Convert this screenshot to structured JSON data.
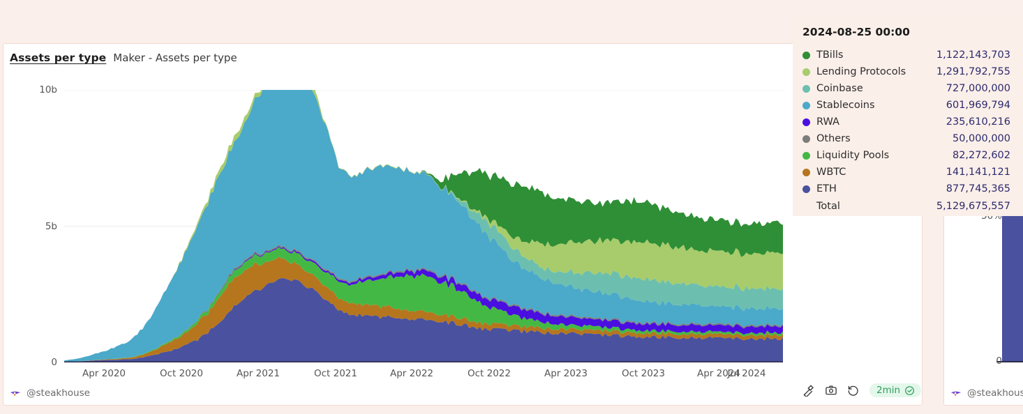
{
  "theme": {
    "page_bg": "#fbefeb",
    "panel_bg": "#ffffff",
    "panel_border": "#f0d9d1",
    "tooltip_bg": "#fbefe9",
    "value_text": "#2b2a6e",
    "badge_green": "#2f9e5c"
  },
  "main_panel": {
    "title": "Assets per type",
    "subtitle": "Maker - Assets per type",
    "watermark": "@steakhouse",
    "footer": {
      "plug_icon": "plug-icon",
      "camera_icon": "camera-icon",
      "undo_icon": "undo-icon",
      "refresh_label": "2min",
      "check_icon": "check-badge-icon"
    }
  },
  "right_panel": {
    "watermark": "@steakhouse",
    "y_ticks": [
      "50%",
      "0"
    ]
  },
  "legend": {
    "items": [
      {
        "label": "RWA",
        "color": "#4a0ee0"
      },
      {
        "label": "Others",
        "color": "#7c7c7c"
      },
      {
        "label": "Liquidity Pools",
        "color": "#44b844"
      },
      {
        "label": "WBTC",
        "color": "#b5761e"
      },
      {
        "label": "ETH",
        "color": "#4a519e"
      }
    ]
  },
  "tooltip": {
    "date": "2024-08-25 00:00",
    "rows": [
      {
        "label": "TBills",
        "value": "1,122,143,703",
        "color": "#2f8f36"
      },
      {
        "label": "Lending Protocols",
        "value": "1,291,792,755",
        "color": "#a8cc6b"
      },
      {
        "label": "Coinbase",
        "value": "727,000,000",
        "color": "#6cbfae"
      },
      {
        "label": "Stablecoins",
        "value": "601,969,794",
        "color": "#4ba9c9"
      },
      {
        "label": "RWA",
        "value": "235,610,216",
        "color": "#4a0ee0"
      },
      {
        "label": "Others",
        "value": "50,000,000",
        "color": "#7c7c7c"
      },
      {
        "label": "Liquidity Pools",
        "value": "82,272,602",
        "color": "#44b844"
      },
      {
        "label": "WBTC",
        "value": "141,141,121",
        "color": "#b5761e"
      },
      {
        "label": "ETH",
        "value": "877,745,365",
        "color": "#4a519e"
      }
    ],
    "total_label": "Total",
    "total_value": "5,129,675,557"
  },
  "chart_data": {
    "type": "area",
    "title": "Maker - Assets per type",
    "xlabel": "",
    "ylabel": "",
    "stacked": true,
    "grid": true,
    "legend_position": "right",
    "ylim": [
      0,
      10000000000
    ],
    "y_ticks": [
      "0",
      "5b",
      "10b"
    ],
    "y_tick_values": [
      0,
      5000000000,
      10000000000
    ],
    "x_ticks": [
      "Apr 2020",
      "Oct 2020",
      "Apr 2021",
      "Oct 2021",
      "Apr 2022",
      "Oct 2022",
      "Apr 2023",
      "Oct 2023",
      "Apr 2024",
      "Jul 2024"
    ],
    "x_range": [
      "2019-12",
      "2024-08-25"
    ],
    "hover_point": "2024-08-25 00:00",
    "units": "USD",
    "series": [
      {
        "name": "ETH",
        "color": "#4a519e",
        "values": [
          0.02,
          0.04,
          0.06,
          0.09,
          0.1,
          0.12,
          0.18,
          0.28,
          0.42,
          0.55,
          0.78,
          1.1,
          1.55,
          2.05,
          2.45,
          2.7,
          2.95,
          3.1,
          2.95,
          2.7,
          2.3,
          1.95,
          1.75,
          1.7,
          1.68,
          1.66,
          1.62,
          1.58,
          1.55,
          1.5,
          1.42,
          1.32,
          1.22,
          1.2,
          1.18,
          1.14,
          1.1,
          1.08,
          1.06,
          1.04,
          1.02,
          1.0,
          0.98,
          0.96,
          0.95,
          0.94,
          0.93,
          0.92,
          0.91,
          0.9,
          0.89,
          0.88,
          0.88,
          0.88,
          0.88,
          0.88
        ]
      },
      {
        "name": "WBTC",
        "color": "#b5761e",
        "values": [
          0.0,
          0.0,
          0.01,
          0.02,
          0.03,
          0.05,
          0.1,
          0.18,
          0.3,
          0.4,
          0.55,
          0.75,
          0.95,
          1.05,
          1.0,
          0.9,
          0.8,
          0.7,
          0.6,
          0.52,
          0.48,
          0.44,
          0.42,
          0.4,
          0.38,
          0.36,
          0.33,
          0.3,
          0.28,
          0.26,
          0.24,
          0.22,
          0.2,
          0.19,
          0.18,
          0.17,
          0.17,
          0.16,
          0.16,
          0.15,
          0.15,
          0.15,
          0.15,
          0.14,
          0.14,
          0.14,
          0.14,
          0.14,
          0.14,
          0.14,
          0.14,
          0.14,
          0.14,
          0.14,
          0.14,
          0.14
        ]
      },
      {
        "name": "Liquidity Pools",
        "color": "#44b844",
        "values": [
          0.0,
          0.0,
          0.0,
          0.0,
          0.01,
          0.01,
          0.02,
          0.03,
          0.05,
          0.07,
          0.1,
          0.14,
          0.2,
          0.26,
          0.3,
          0.32,
          0.34,
          0.36,
          0.4,
          0.45,
          0.52,
          0.6,
          0.7,
          0.85,
          1.0,
          1.15,
          1.25,
          1.3,
          1.28,
          1.2,
          1.05,
          0.88,
          0.7,
          0.55,
          0.42,
          0.32,
          0.25,
          0.2,
          0.17,
          0.15,
          0.14,
          0.13,
          0.12,
          0.11,
          0.1,
          0.1,
          0.09,
          0.09,
          0.09,
          0.09,
          0.08,
          0.08,
          0.08,
          0.08,
          0.08,
          0.08
        ]
      },
      {
        "name": "RWA",
        "color": "#4a0ee0",
        "values": [
          0.0,
          0.0,
          0.0,
          0.0,
          0.0,
          0.0,
          0.0,
          0.0,
          0.0,
          0.0,
          0.0,
          0.0,
          0.01,
          0.02,
          0.03,
          0.03,
          0.03,
          0.04,
          0.05,
          0.06,
          0.06,
          0.07,
          0.08,
          0.1,
          0.12,
          0.14,
          0.16,
          0.18,
          0.2,
          0.22,
          0.24,
          0.26,
          0.28,
          0.3,
          0.32,
          0.32,
          0.31,
          0.3,
          0.29,
          0.28,
          0.27,
          0.26,
          0.26,
          0.25,
          0.25,
          0.24,
          0.24,
          0.24,
          0.24,
          0.24,
          0.24,
          0.24,
          0.24,
          0.24,
          0.24,
          0.24
        ]
      },
      {
        "name": "Others",
        "color": "#7c7c7c",
        "values": [
          0.0,
          0.0,
          0.0,
          0.0,
          0.0,
          0.0,
          0.0,
          0.0,
          0.01,
          0.01,
          0.02,
          0.03,
          0.04,
          0.05,
          0.05,
          0.05,
          0.05,
          0.05,
          0.05,
          0.05,
          0.05,
          0.05,
          0.05,
          0.05,
          0.05,
          0.05,
          0.05,
          0.05,
          0.05,
          0.05,
          0.05,
          0.05,
          0.05,
          0.05,
          0.05,
          0.05,
          0.05,
          0.05,
          0.05,
          0.05,
          0.05,
          0.05,
          0.05,
          0.05,
          0.05,
          0.05,
          0.05,
          0.05,
          0.05,
          0.05,
          0.05,
          0.05,
          0.05,
          0.05,
          0.05,
          0.05
        ]
      },
      {
        "name": "Stablecoins",
        "color": "#4ba9c9",
        "values": [
          0.05,
          0.1,
          0.18,
          0.3,
          0.45,
          0.62,
          0.95,
          1.45,
          2.1,
          2.7,
          3.3,
          3.9,
          4.3,
          4.6,
          5.1,
          5.9,
          6.4,
          6.6,
          6.5,
          6.2,
          5.3,
          4.1,
          3.8,
          3.9,
          4.0,
          3.85,
          3.7,
          3.55,
          3.4,
          3.2,
          2.95,
          2.7,
          2.4,
          2.05,
          1.7,
          1.45,
          1.3,
          1.2,
          1.1,
          1.05,
          1.0,
          0.95,
          0.9,
          0.85,
          0.8,
          0.75,
          0.72,
          0.7,
          0.68,
          0.66,
          0.64,
          0.63,
          0.62,
          0.61,
          0.6,
          0.6
        ]
      },
      {
        "name": "Coinbase",
        "color": "#6cbfae",
        "values": [
          0.0,
          0.0,
          0.0,
          0.0,
          0.0,
          0.0,
          0.0,
          0.0,
          0.0,
          0.0,
          0.0,
          0.0,
          0.0,
          0.0,
          0.0,
          0.0,
          0.0,
          0.0,
          0.0,
          0.0,
          0.0,
          0.0,
          0.0,
          0.0,
          0.0,
          0.0,
          0.0,
          0.0,
          0.0,
          0.0,
          0.1,
          0.25,
          0.45,
          0.5,
          0.48,
          0.45,
          0.42,
          0.4,
          0.45,
          0.55,
          0.65,
          0.72,
          0.76,
          0.78,
          0.8,
          0.8,
          0.78,
          0.76,
          0.75,
          0.74,
          0.73,
          0.73,
          0.73,
          0.73,
          0.73,
          0.73
        ]
      },
      {
        "name": "Lending Protocols",
        "color": "#a8cc6b",
        "values": [
          0.0,
          0.0,
          0.0,
          0.0,
          0.0,
          0.0,
          0.0,
          0.0,
          0.0,
          0.05,
          0.1,
          0.15,
          0.2,
          0.22,
          0.2,
          0.15,
          0.12,
          0.1,
          0.2,
          0.25,
          0.05,
          0.02,
          0.02,
          0.02,
          0.02,
          0.02,
          0.02,
          0.02,
          0.02,
          0.02,
          0.03,
          0.05,
          0.1,
          0.2,
          0.35,
          0.55,
          0.75,
          0.95,
          1.05,
          1.1,
          1.15,
          1.2,
          1.25,
          1.28,
          1.3,
          1.32,
          1.33,
          1.32,
          1.31,
          1.3,
          1.3,
          1.29,
          1.29,
          1.29,
          1.29,
          1.29
        ]
      },
      {
        "name": "TBills",
        "color": "#2f8f36",
        "values": [
          0.0,
          0.0,
          0.0,
          0.0,
          0.0,
          0.0,
          0.0,
          0.0,
          0.0,
          0.0,
          0.0,
          0.0,
          0.0,
          0.0,
          0.0,
          0.0,
          0.0,
          0.0,
          0.0,
          0.0,
          0.0,
          0.0,
          0.0,
          0.0,
          0.0,
          0.0,
          0.0,
          0.0,
          0.05,
          0.3,
          0.8,
          1.25,
          1.55,
          1.75,
          1.9,
          2.0,
          1.95,
          1.85,
          1.7,
          1.55,
          1.45,
          1.4,
          1.45,
          1.5,
          1.48,
          1.42,
          1.35,
          1.28,
          1.22,
          1.18,
          1.15,
          1.13,
          1.12,
          1.12,
          1.12,
          1.12
        ]
      }
    ]
  }
}
